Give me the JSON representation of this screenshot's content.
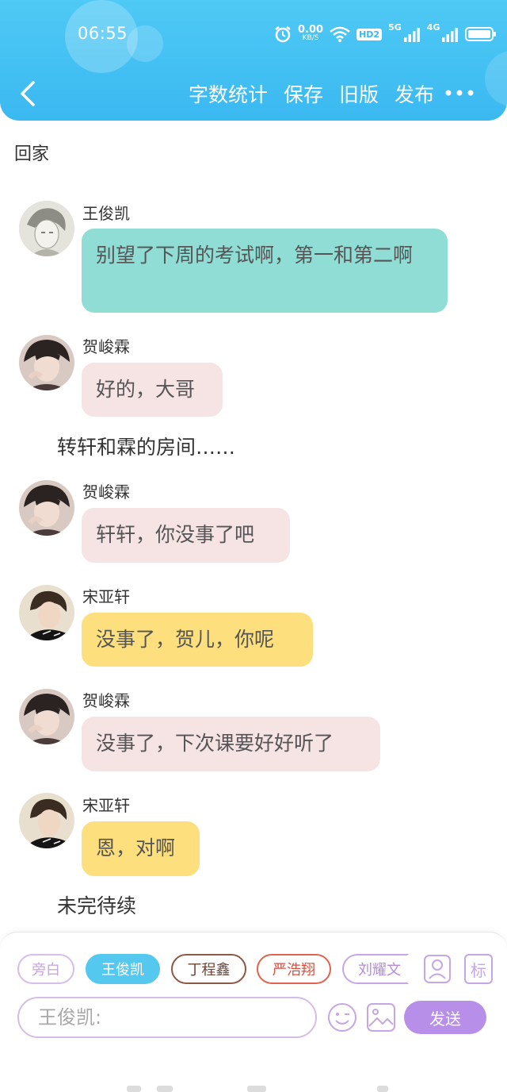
{
  "status_bar": {
    "time": "06:55",
    "net_speed_value": "0.00",
    "net_speed_unit": "KB/S",
    "hd_label": "HD2",
    "network_5g": "5G",
    "network_4g": "4G"
  },
  "nav": {
    "actions": [
      "字数统计",
      "保存",
      "旧版",
      "发布"
    ]
  },
  "story": {
    "title": "回家",
    "messages": [
      {
        "speaker": "王俊凯",
        "text": "别望了下周的考试啊，第一和第二啊",
        "color": "#90ddd6"
      },
      {
        "speaker": "贺峻霖",
        "text": "好的，大哥",
        "color": "#f6e3e3"
      },
      {
        "narration": "转轩和霖的房间……"
      },
      {
        "speaker": "贺峻霖",
        "text": "轩轩，你没事了吧",
        "color": "#f6e3e3"
      },
      {
        "speaker": "宋亚轩",
        "text": "没事了，贺儿，你呢",
        "color": "#fddf7e"
      },
      {
        "speaker": "贺峻霖",
        "text": "没事了，下次课要好好听了",
        "color": "#f6e3e3"
      },
      {
        "speaker": "宋亚轩",
        "text": "恩，对啊",
        "color": "#fddf7e"
      },
      {
        "narration": "未完待续"
      }
    ]
  },
  "composer": {
    "roles": [
      {
        "label": "旁白",
        "color": "#d7bde9",
        "selected": false
      },
      {
        "label": "王俊凯",
        "color": "#55c8ef",
        "selected": true
      },
      {
        "label": "丁程鑫",
        "color": "#8a5a44",
        "selected": false
      },
      {
        "label": "严浩翔",
        "color": "#e0634f",
        "selected": false
      },
      {
        "label": "刘耀文",
        "color": "#c5a6e6",
        "selected": false
      }
    ],
    "mark_label": "标",
    "input_placeholder": "王俊凯:",
    "send_label": "发送"
  },
  "colors": {
    "header": "#3ab9f1",
    "accent_purple": "#b78fe8"
  },
  "icons": [
    "back-arrow-icon",
    "alarm-icon",
    "wifi-icon",
    "signal-icon",
    "battery-icon",
    "more-dots-icon",
    "add-role-icon",
    "emoji-icon",
    "image-icon"
  ]
}
